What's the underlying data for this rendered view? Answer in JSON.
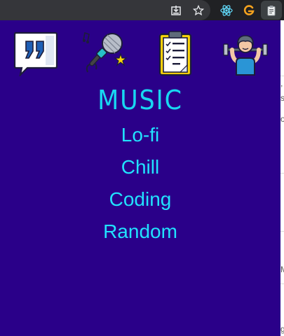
{
  "browser": {
    "icons": [
      "download-to-page-icon",
      "star-bookmark-icon",
      "react-devtools-icon",
      "extension-g-icon",
      "clipboard-extension-icon"
    ]
  },
  "popup": {
    "title": "MUSIC",
    "icons": [
      "quote-bubble-icon",
      "microphone-icon",
      "clipboard-checklist-icon",
      "weightlifter-icon"
    ],
    "menu": [
      {
        "label": "Lo-fi"
      },
      {
        "label": "Chill"
      },
      {
        "label": "Coding"
      },
      {
        "label": "Random"
      }
    ]
  },
  "colors": {
    "background": "#2a0089",
    "accent": "#21e3ff"
  }
}
